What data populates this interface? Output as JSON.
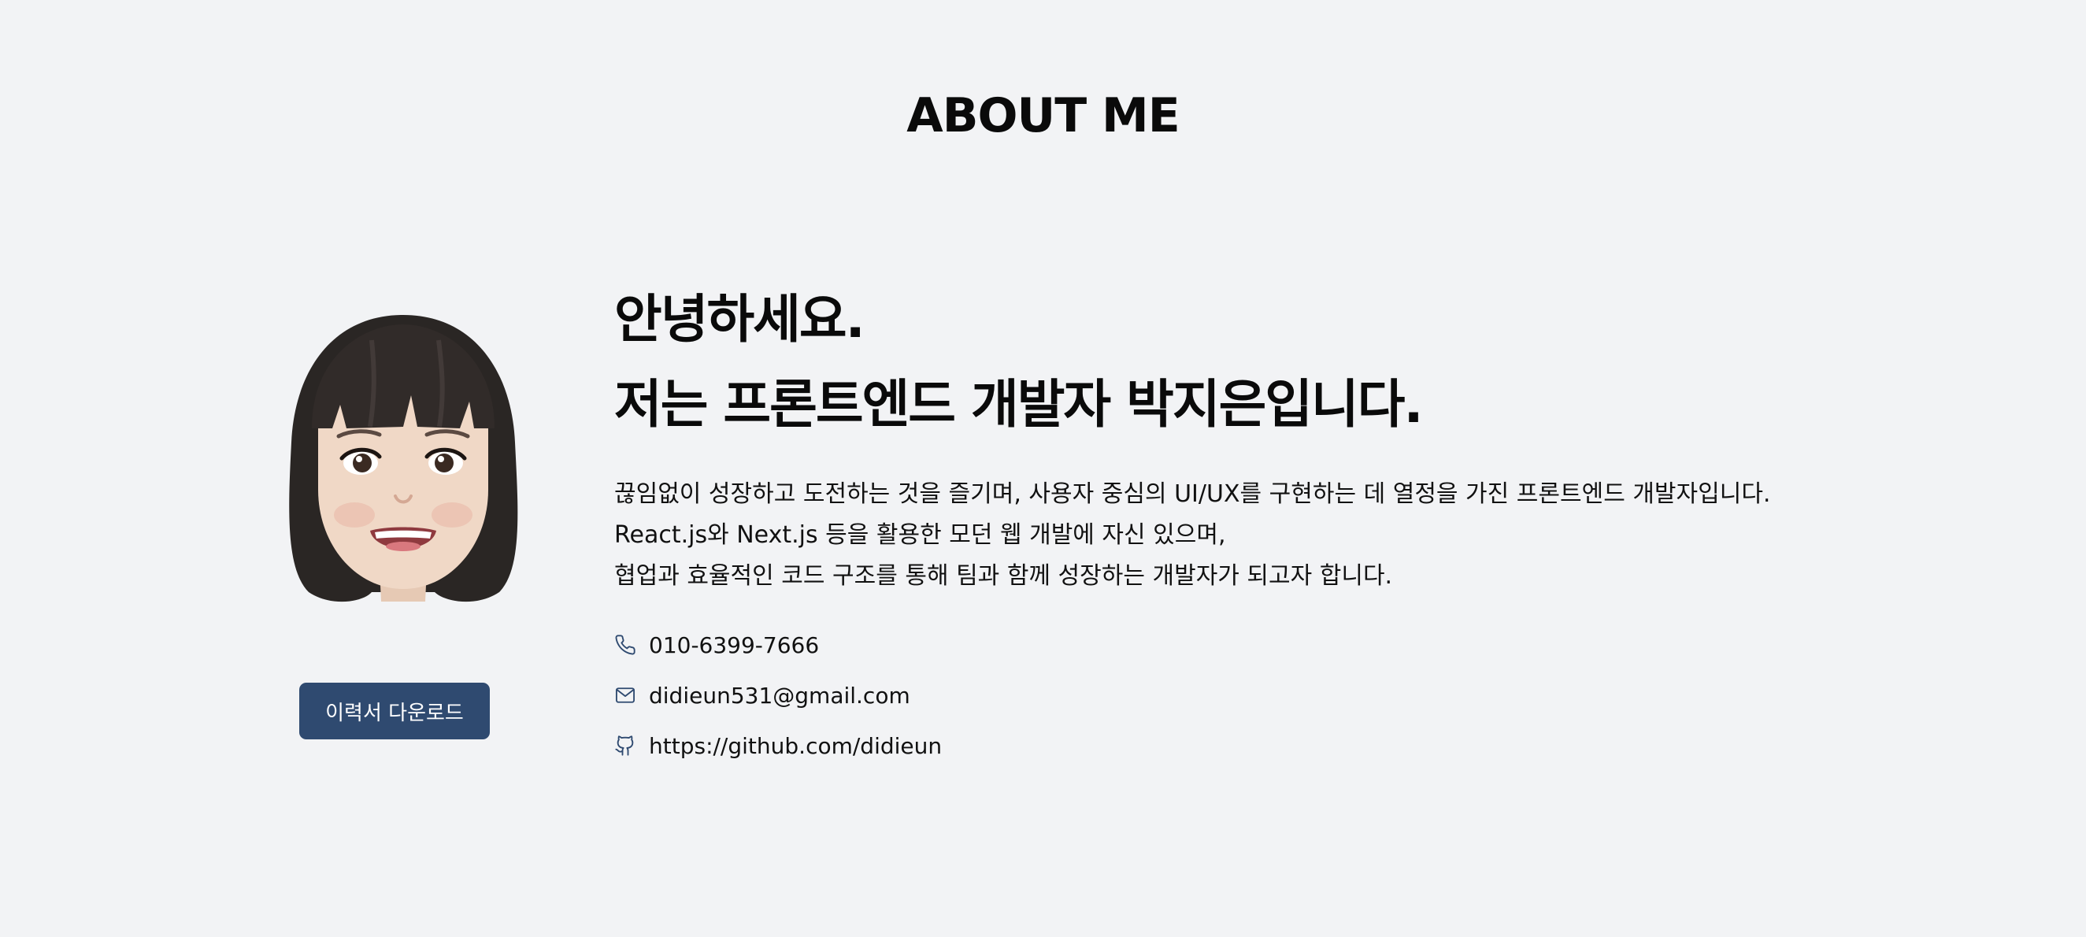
{
  "about": {
    "title": "ABOUT ME"
  },
  "profile": {
    "avatar_icon": "memoji-avatar-icon",
    "resume_button_label": "이력서 다운로드",
    "button_color": "#2f4a70"
  },
  "intro": {
    "headline": [
      "안녕하세요.",
      "저는 프론트엔드 개발자 박지은입니다."
    ],
    "description": [
      "끊임없이 성장하고 도전하는 것을 즐기며, 사용자 중심의 UI/UX를 구현하는 데 열정을 가진 프론트엔드 개발자입니다.",
      "React.js와 Next.js 등을 활용한 모던 웹 개발에 자신 있으며,",
      "협업과 효율적인 코드 구조를 통해 팀과 함께 성장하는 개발자가 되고자 합니다."
    ]
  },
  "contacts": [
    {
      "icon": "phone-icon",
      "text": "010-6399-7666"
    },
    {
      "icon": "mail-icon",
      "text": "didieun531@gmail.com"
    },
    {
      "icon": "github-icon",
      "text": "https://github.com/didieun"
    }
  ],
  "colors": {
    "background": "#f2f3f5",
    "icon": "#2f4a70",
    "text": "#111111"
  }
}
